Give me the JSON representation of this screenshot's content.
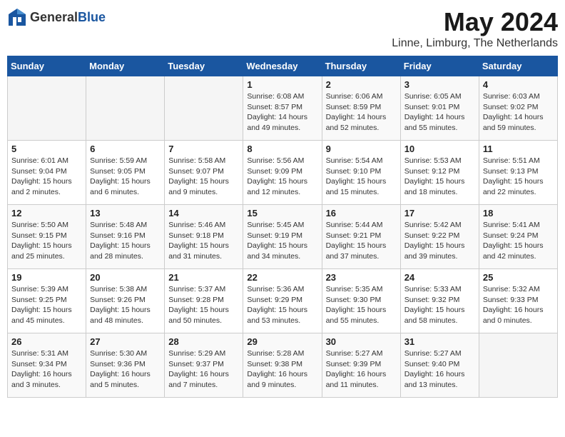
{
  "logo": {
    "text_general": "General",
    "text_blue": "Blue"
  },
  "title": "May 2024",
  "subtitle": "Linne, Limburg, The Netherlands",
  "headers": [
    "Sunday",
    "Monday",
    "Tuesday",
    "Wednesday",
    "Thursday",
    "Friday",
    "Saturday"
  ],
  "weeks": [
    [
      {
        "day": "",
        "sunrise": "",
        "sunset": "",
        "daylight": ""
      },
      {
        "day": "",
        "sunrise": "",
        "sunset": "",
        "daylight": ""
      },
      {
        "day": "",
        "sunrise": "",
        "sunset": "",
        "daylight": ""
      },
      {
        "day": "1",
        "sunrise": "Sunrise: 6:08 AM",
        "sunset": "Sunset: 8:57 PM",
        "daylight": "Daylight: 14 hours and 49 minutes."
      },
      {
        "day": "2",
        "sunrise": "Sunrise: 6:06 AM",
        "sunset": "Sunset: 8:59 PM",
        "daylight": "Daylight: 14 hours and 52 minutes."
      },
      {
        "day": "3",
        "sunrise": "Sunrise: 6:05 AM",
        "sunset": "Sunset: 9:01 PM",
        "daylight": "Daylight: 14 hours and 55 minutes."
      },
      {
        "day": "4",
        "sunrise": "Sunrise: 6:03 AM",
        "sunset": "Sunset: 9:02 PM",
        "daylight": "Daylight: 14 hours and 59 minutes."
      }
    ],
    [
      {
        "day": "5",
        "sunrise": "Sunrise: 6:01 AM",
        "sunset": "Sunset: 9:04 PM",
        "daylight": "Daylight: 15 hours and 2 minutes."
      },
      {
        "day": "6",
        "sunrise": "Sunrise: 5:59 AM",
        "sunset": "Sunset: 9:05 PM",
        "daylight": "Daylight: 15 hours and 6 minutes."
      },
      {
        "day": "7",
        "sunrise": "Sunrise: 5:58 AM",
        "sunset": "Sunset: 9:07 PM",
        "daylight": "Daylight: 15 hours and 9 minutes."
      },
      {
        "day": "8",
        "sunrise": "Sunrise: 5:56 AM",
        "sunset": "Sunset: 9:09 PM",
        "daylight": "Daylight: 15 hours and 12 minutes."
      },
      {
        "day": "9",
        "sunrise": "Sunrise: 5:54 AM",
        "sunset": "Sunset: 9:10 PM",
        "daylight": "Daylight: 15 hours and 15 minutes."
      },
      {
        "day": "10",
        "sunrise": "Sunrise: 5:53 AM",
        "sunset": "Sunset: 9:12 PM",
        "daylight": "Daylight: 15 hours and 18 minutes."
      },
      {
        "day": "11",
        "sunrise": "Sunrise: 5:51 AM",
        "sunset": "Sunset: 9:13 PM",
        "daylight": "Daylight: 15 hours and 22 minutes."
      }
    ],
    [
      {
        "day": "12",
        "sunrise": "Sunrise: 5:50 AM",
        "sunset": "Sunset: 9:15 PM",
        "daylight": "Daylight: 15 hours and 25 minutes."
      },
      {
        "day": "13",
        "sunrise": "Sunrise: 5:48 AM",
        "sunset": "Sunset: 9:16 PM",
        "daylight": "Daylight: 15 hours and 28 minutes."
      },
      {
        "day": "14",
        "sunrise": "Sunrise: 5:46 AM",
        "sunset": "Sunset: 9:18 PM",
        "daylight": "Daylight: 15 hours and 31 minutes."
      },
      {
        "day": "15",
        "sunrise": "Sunrise: 5:45 AM",
        "sunset": "Sunset: 9:19 PM",
        "daylight": "Daylight: 15 hours and 34 minutes."
      },
      {
        "day": "16",
        "sunrise": "Sunrise: 5:44 AM",
        "sunset": "Sunset: 9:21 PM",
        "daylight": "Daylight: 15 hours and 37 minutes."
      },
      {
        "day": "17",
        "sunrise": "Sunrise: 5:42 AM",
        "sunset": "Sunset: 9:22 PM",
        "daylight": "Daylight: 15 hours and 39 minutes."
      },
      {
        "day": "18",
        "sunrise": "Sunrise: 5:41 AM",
        "sunset": "Sunset: 9:24 PM",
        "daylight": "Daylight: 15 hours and 42 minutes."
      }
    ],
    [
      {
        "day": "19",
        "sunrise": "Sunrise: 5:39 AM",
        "sunset": "Sunset: 9:25 PM",
        "daylight": "Daylight: 15 hours and 45 minutes."
      },
      {
        "day": "20",
        "sunrise": "Sunrise: 5:38 AM",
        "sunset": "Sunset: 9:26 PM",
        "daylight": "Daylight: 15 hours and 48 minutes."
      },
      {
        "day": "21",
        "sunrise": "Sunrise: 5:37 AM",
        "sunset": "Sunset: 9:28 PM",
        "daylight": "Daylight: 15 hours and 50 minutes."
      },
      {
        "day": "22",
        "sunrise": "Sunrise: 5:36 AM",
        "sunset": "Sunset: 9:29 PM",
        "daylight": "Daylight: 15 hours and 53 minutes."
      },
      {
        "day": "23",
        "sunrise": "Sunrise: 5:35 AM",
        "sunset": "Sunset: 9:30 PM",
        "daylight": "Daylight: 15 hours and 55 minutes."
      },
      {
        "day": "24",
        "sunrise": "Sunrise: 5:33 AM",
        "sunset": "Sunset: 9:32 PM",
        "daylight": "Daylight: 15 hours and 58 minutes."
      },
      {
        "day": "25",
        "sunrise": "Sunrise: 5:32 AM",
        "sunset": "Sunset: 9:33 PM",
        "daylight": "Daylight: 16 hours and 0 minutes."
      }
    ],
    [
      {
        "day": "26",
        "sunrise": "Sunrise: 5:31 AM",
        "sunset": "Sunset: 9:34 PM",
        "daylight": "Daylight: 16 hours and 3 minutes."
      },
      {
        "day": "27",
        "sunrise": "Sunrise: 5:30 AM",
        "sunset": "Sunset: 9:36 PM",
        "daylight": "Daylight: 16 hours and 5 minutes."
      },
      {
        "day": "28",
        "sunrise": "Sunrise: 5:29 AM",
        "sunset": "Sunset: 9:37 PM",
        "daylight": "Daylight: 16 hours and 7 minutes."
      },
      {
        "day": "29",
        "sunrise": "Sunrise: 5:28 AM",
        "sunset": "Sunset: 9:38 PM",
        "daylight": "Daylight: 16 hours and 9 minutes."
      },
      {
        "day": "30",
        "sunrise": "Sunrise: 5:27 AM",
        "sunset": "Sunset: 9:39 PM",
        "daylight": "Daylight: 16 hours and 11 minutes."
      },
      {
        "day": "31",
        "sunrise": "Sunrise: 5:27 AM",
        "sunset": "Sunset: 9:40 PM",
        "daylight": "Daylight: 16 hours and 13 minutes."
      },
      {
        "day": "",
        "sunrise": "",
        "sunset": "",
        "daylight": ""
      }
    ]
  ]
}
